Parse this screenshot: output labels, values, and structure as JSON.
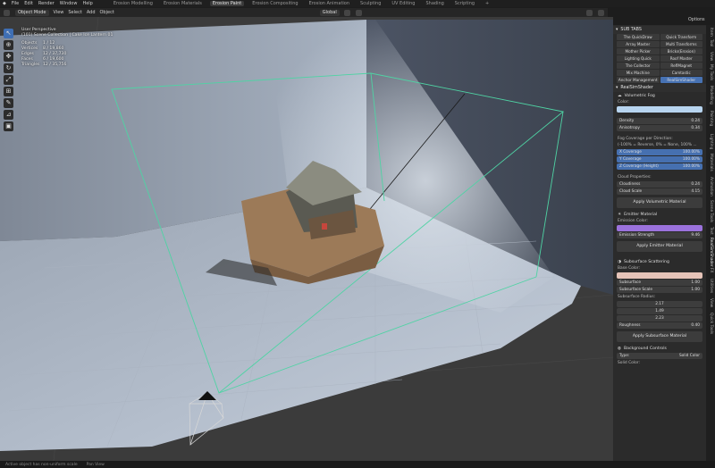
{
  "menu": [
    "File",
    "Edit",
    "Render",
    "Window",
    "Help"
  ],
  "workspaces": [
    "Erosion Modelling",
    "Erosion Materials",
    "Erosion Paint",
    "Erosion Compositing",
    "Erosion Animation",
    "Sculpting",
    "UV Editing",
    "Shading",
    "Scripting",
    "+"
  ],
  "active_workspace": "Erosion Paint",
  "options_label": "Options",
  "header": {
    "mode": "Object Mode",
    "menus": [
      "View",
      "Select",
      "Add",
      "Object"
    ],
    "orientation": "Global"
  },
  "overlay": {
    "view": "User Perspective",
    "collection": "(101) Scene Collection | Cake Ice Lantern 01",
    "stats": [
      {
        "k": "Objects",
        "v": "1 / 12"
      },
      {
        "k": "Vertices",
        "v": "8 / 19,860"
      },
      {
        "k": "Edges",
        "v": "12 / 37,730"
      },
      {
        "k": "Faces",
        "v": "6 / 19,600"
      },
      {
        "k": "Triangles",
        "v": "12 / 35,756"
      }
    ]
  },
  "npanel": {
    "subtabs_title": "SUB TABS",
    "subtabs": [
      "The QuickDraw",
      "Quick Transform",
      "Array Master",
      "Multi Transforms",
      "Mother Picker",
      "Bricks(Erosion)",
      "Lighting Quick",
      "Roof Master",
      "The Collector",
      "ReflMagnet",
      "Mix Machine",
      "Camtastic",
      "Anchor Management",
      "RealSimShader"
    ],
    "subtab_selected": "RealSimShader",
    "section_title": "RealSimShader",
    "fog": {
      "title": "Volumetric Fog",
      "color_label": "Color:",
      "color": "#b7d4ef",
      "density_label": "Density",
      "density": "0.24",
      "anisotropy_label": "Anisotropy",
      "anisotropy": "0.34",
      "coverage_title": "Fog Coverage per Direction:",
      "coverage_note": "(-100% = Reverse, 0% = None, 100% ...",
      "coverages": [
        {
          "label": "X Coverage",
          "value": "100.00%"
        },
        {
          "label": "Y Coverage",
          "value": "100.00%"
        },
        {
          "label": "Z Coverage (Height)",
          "value": "100.00%"
        }
      ],
      "cloud_title": "Cloud Properties:",
      "cloudiness_label": "Cloudiness",
      "cloudiness": "0.24",
      "cloud_scale_label": "Cloud Scale",
      "cloud_scale": "4.15",
      "apply": "Apply Volumetric Material"
    },
    "emitter": {
      "title": "Emitter Material",
      "color_label": "Emission Color:",
      "color": "#9b72dc",
      "strength_label": "Emission Strength",
      "strength": "9.46",
      "apply": "Apply Emitter Material"
    },
    "sss": {
      "title": "Subsurface Scattering",
      "base_label": "Base Color:",
      "base_color": "#e5c3b8",
      "subsurface_label": "Subsurface",
      "subsurface": "1.00",
      "scale_label": "Subsurface Scale",
      "scale": "1.00",
      "radius_label": "Subsurface Radius:",
      "radius": [
        "2.17",
        "1.49",
        "2.23"
      ],
      "roughness_label": "Roughness",
      "roughness": "0.40",
      "apply": "Apply Subsurface Material"
    },
    "background": {
      "title": "Background Controls",
      "type_label": "Type:",
      "type": "Solid Color",
      "solid_label": "Solid Color:"
    }
  },
  "vertical_tabs": [
    "Item",
    "Tool",
    "View",
    "My Tools",
    "Modelling",
    "Painting",
    "Lighting",
    "Materials",
    "Animation",
    "Scene Tools",
    "Text",
    "RealSimShader",
    "FX",
    "Utilities",
    "View",
    "Quick Tools"
  ],
  "status": {
    "left": "Active object has non-uniform scale",
    "right": "Pan View"
  }
}
